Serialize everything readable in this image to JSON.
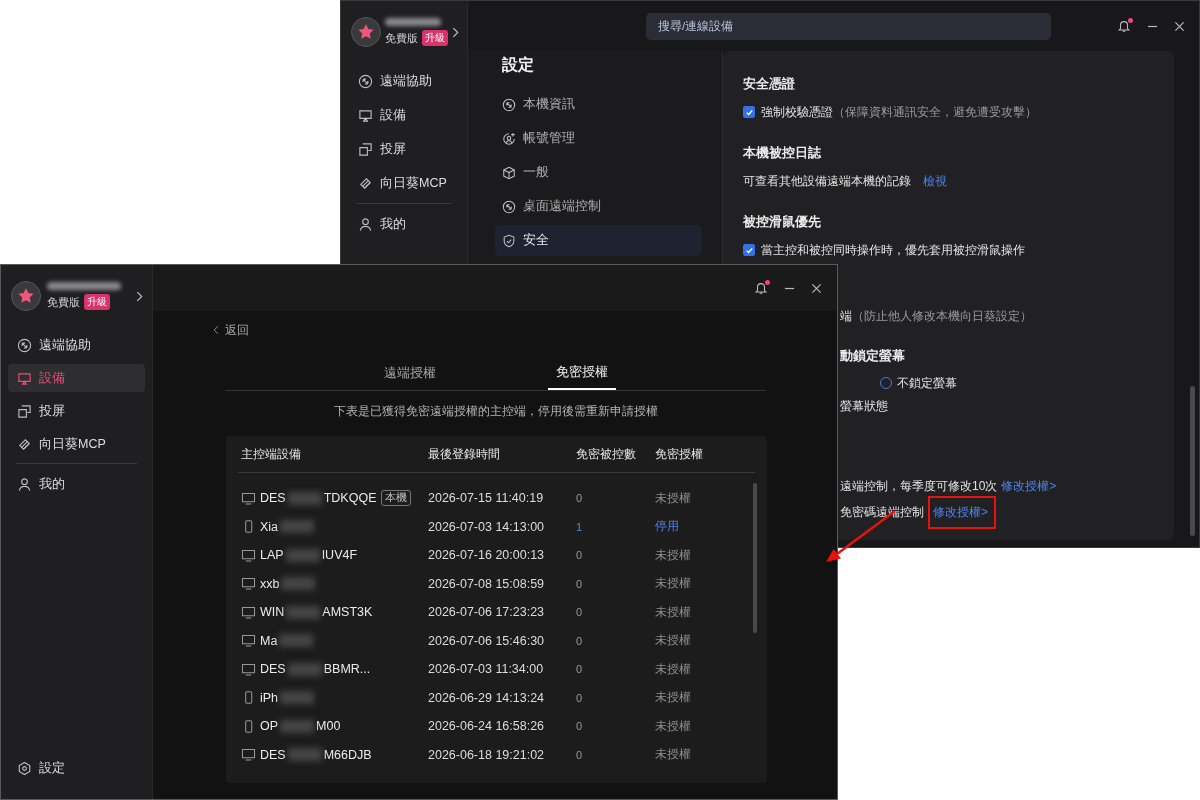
{
  "back_window": {
    "sidebar": {
      "plan": "免費版",
      "upgrade": "升級",
      "items": [
        {
          "kind": "assist",
          "label": "遠端協助",
          "selected": false
        },
        {
          "kind": "device",
          "label": "設備",
          "selected": false
        },
        {
          "kind": "cast",
          "label": "投屏",
          "selected": false
        },
        {
          "kind": "mcp",
          "label": "向日葵MCP",
          "selected": false
        },
        {
          "kind": "me",
          "label": "我的",
          "selected": false
        }
      ]
    },
    "search": {
      "placeholder": "搜尋/連線設備"
    },
    "notification_dot": true,
    "settings": {
      "title": "設定",
      "items": [
        {
          "kind": "info",
          "label": "本機資訊",
          "selected": false
        },
        {
          "kind": "account",
          "label": "帳號管理",
          "selected": false
        },
        {
          "kind": "general",
          "label": "一般",
          "selected": false
        },
        {
          "kind": "remote",
          "label": "桌面遠端控制",
          "selected": false
        },
        {
          "kind": "security",
          "label": "安全",
          "selected": true
        }
      ]
    },
    "sections": [
      {
        "heading": "安全憑證",
        "rows": [
          {
            "kind": "checkbox",
            "checked": true,
            "label": "強制校驗憑證",
            "hint": "（保障資料通訊安全，避免遭受攻擊）"
          }
        ]
      },
      {
        "heading": "本機被控日誌",
        "rows": [
          {
            "kind": "link",
            "label": "可查看其他設備遠端本機的記錄",
            "link": "檢視"
          }
        ]
      },
      {
        "heading": "被控滑鼠優先",
        "rows": [
          {
            "kind": "checkbox",
            "checked": true,
            "label": "當主控和被控同時操作時，優先套用被控滑鼠操作"
          }
        ]
      }
    ],
    "partly_covered": [
      {
        "kind": "hint",
        "label": "端",
        "hint": "（防止他人修改本機向日葵設定）"
      },
      {
        "kind": "heading",
        "label": "動鎖定螢幕"
      },
      {
        "kind": "radio",
        "checked": false,
        "label": "不鎖定螢幕"
      },
      {
        "kind": "text",
        "label": "螢幕狀態"
      },
      {
        "kind": "link",
        "label": "遠端控制，每季度可修改10次",
        "link": "修改授權>",
        "highlighted": false
      },
      {
        "kind": "link",
        "label": "免密碼遠端控制",
        "link": "修改授權>",
        "highlighted": true
      }
    ]
  },
  "front_window": {
    "sidebar": {
      "plan": "免費版",
      "upgrade": "升級",
      "items": [
        {
          "kind": "assist",
          "label": "遠端協助",
          "selected": false
        },
        {
          "kind": "device",
          "label": "設備",
          "selected": true
        },
        {
          "kind": "cast",
          "label": "投屏",
          "selected": false
        },
        {
          "kind": "mcp",
          "label": "向日葵MCP",
          "selected": false
        },
        {
          "kind": "me",
          "label": "我的",
          "selected": false
        }
      ],
      "settings_label": "設定"
    },
    "notification_dot": true,
    "back": "返回",
    "tabs": [
      {
        "label": "遠端授權",
        "selected": false
      },
      {
        "label": "免密授權",
        "selected": true
      }
    ],
    "description": "下表是已獲得免密遠端授權的主控端，停用後需重新申請授權",
    "table": {
      "columns": [
        "主控端設備",
        "最後登錄時間",
        "免密被控數",
        "免密授權"
      ],
      "rows": [
        {
          "kind": "desktop",
          "name_start": "DES",
          "name_end": "TDKQQE",
          "tag": "本機",
          "last_login": "2026-07-15 11:40:19",
          "count": "0",
          "action": "未授權",
          "enabled": false
        },
        {
          "kind": "phone",
          "name_start": "Xia",
          "last_login": "2026-07-03 14:13:00",
          "count": "1",
          "action": "停用",
          "enabled": true
        },
        {
          "kind": "desktop",
          "name_start": "LAP",
          "name_end": "IUV4F",
          "last_login": "2026-07-16 20:00:13",
          "count": "0",
          "action": "未授權",
          "enabled": false
        },
        {
          "kind": "desktop",
          "name_start": "xxb",
          "last_login": "2026-07-08 15:08:59",
          "count": "0",
          "action": "未授權",
          "enabled": false
        },
        {
          "kind": "desktop",
          "name_start": "WIN",
          "name_end": "AMST3K",
          "last_login": "2026-07-06 17:23:23",
          "count": "0",
          "action": "未授權",
          "enabled": false
        },
        {
          "kind": "desktop",
          "name_start": "Ma",
          "last_login": "2026-07-06 15:46:30",
          "count": "0",
          "action": "未授權",
          "enabled": false
        },
        {
          "kind": "desktop",
          "name_start": "DES",
          "name_end": "BBMR...",
          "last_login": "2026-07-03 11:34:00",
          "count": "0",
          "action": "未授權",
          "enabled": false
        },
        {
          "kind": "phone",
          "name_start": "iPh",
          "last_login": "2026-06-29 14:13:24",
          "count": "0",
          "action": "未授權",
          "enabled": false
        },
        {
          "kind": "phone",
          "name_start": "OP",
          "name_end": "M00",
          "last_login": "2026-06-24 16:58:26",
          "count": "0",
          "action": "未授權",
          "enabled": false
        },
        {
          "kind": "desktop",
          "name_start": "DES",
          "name_end": "M66DJB",
          "last_login": "2026-06-18 19:21:02",
          "count": "0",
          "action": "未授權",
          "enabled": false
        }
      ]
    }
  }
}
